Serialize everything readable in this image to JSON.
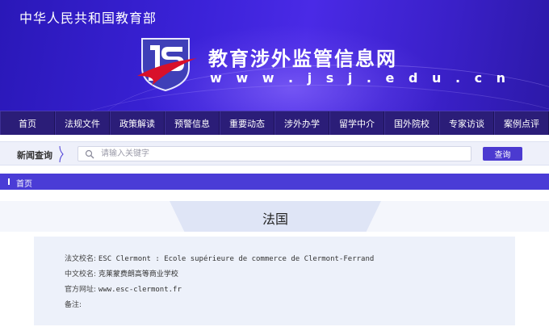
{
  "header": {
    "ministry_name": "中华人民共和国教育部",
    "site_title": "教育涉外监管信息网",
    "site_url": "w w w . j s j . e d u . c n",
    "colors": {
      "banner": "#3b22d8",
      "logo_blue": "#2b2f9e",
      "logo_red": "#d8102a"
    }
  },
  "nav": {
    "items": [
      {
        "label": "首页"
      },
      {
        "label": "法规文件"
      },
      {
        "label": "政策解读"
      },
      {
        "label": "预警信息"
      },
      {
        "label": "重要动态"
      },
      {
        "label": "涉外办学"
      },
      {
        "label": "留学中介"
      },
      {
        "label": "国外院校"
      },
      {
        "label": "专家访谈"
      },
      {
        "label": "案例点评"
      }
    ]
  },
  "search": {
    "label": "新闻查询",
    "placeholder": "请输入关键字",
    "button_label": "查询",
    "icon": "search-icon"
  },
  "breadcrumb": {
    "home_label": "首页"
  },
  "page": {
    "country_title": "法国"
  },
  "institution": {
    "foreign_name_label": "法文校名:",
    "foreign_name": "ESC Clermont : Ecole supérieure de commerce de Clermont-Ferrand",
    "chinese_name_label": "中文校名:",
    "chinese_name": "克莱蒙费朗高等商业学校",
    "website_label": "官方网址:",
    "website": "www.esc-clermont.fr",
    "notes_label": "备注:",
    "notes": ""
  }
}
